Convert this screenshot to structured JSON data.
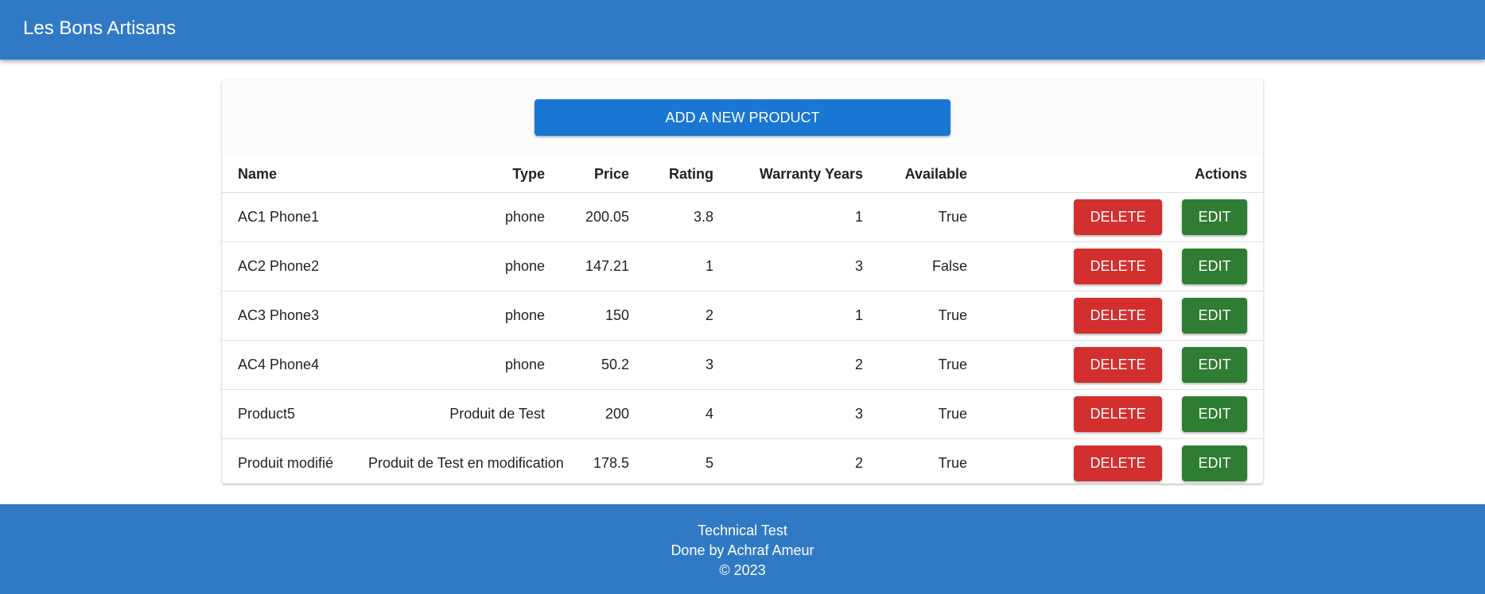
{
  "header": {
    "title": "Les Bons Artisans"
  },
  "toolbar": {
    "add_label": "ADD A NEW PRODUCT"
  },
  "table": {
    "columns": {
      "name": "Name",
      "type": "Type",
      "price": "Price",
      "rating": "Rating",
      "warranty": "Warranty Years",
      "available": "Available",
      "actions": "Actions"
    },
    "rows": [
      {
        "name": "AC1 Phone1",
        "type": "phone",
        "price": "200.05",
        "rating": "3.8",
        "warranty": "1",
        "available": "True",
        "delete_label": "DELETE",
        "edit_label": "EDIT"
      },
      {
        "name": "AC2 Phone2",
        "type": "phone",
        "price": "147.21",
        "rating": "1",
        "warranty": "3",
        "available": "False",
        "delete_label": "DELETE",
        "edit_label": "EDIT"
      },
      {
        "name": "AC3 Phone3",
        "type": "phone",
        "price": "150",
        "rating": "2",
        "warranty": "1",
        "available": "True",
        "delete_label": "DELETE",
        "edit_label": "EDIT"
      },
      {
        "name": "AC4 Phone4",
        "type": "phone",
        "price": "50.2",
        "rating": "3",
        "warranty": "2",
        "available": "True",
        "delete_label": "DELETE",
        "edit_label": "EDIT"
      },
      {
        "name": "Product5",
        "type": "Produit de Test",
        "price": "200",
        "rating": "4",
        "warranty": "3",
        "available": "True",
        "delete_label": "DELETE",
        "edit_label": "EDIT"
      },
      {
        "name": "Produit modifié",
        "type": "Produit de Test en modification",
        "price": "178.5",
        "rating": "5",
        "warranty": "2",
        "available": "True",
        "delete_label": "DELETE",
        "edit_label": "EDIT"
      }
    ]
  },
  "footer": {
    "line1": "Technical Test",
    "line2": "Done by Achraf Ameur",
    "line3": "© 2023"
  },
  "colors": {
    "appbar": "#3079c4",
    "primary_button": "#1976d2",
    "delete_button": "#d32f2f",
    "edit_button": "#2e7d32"
  }
}
